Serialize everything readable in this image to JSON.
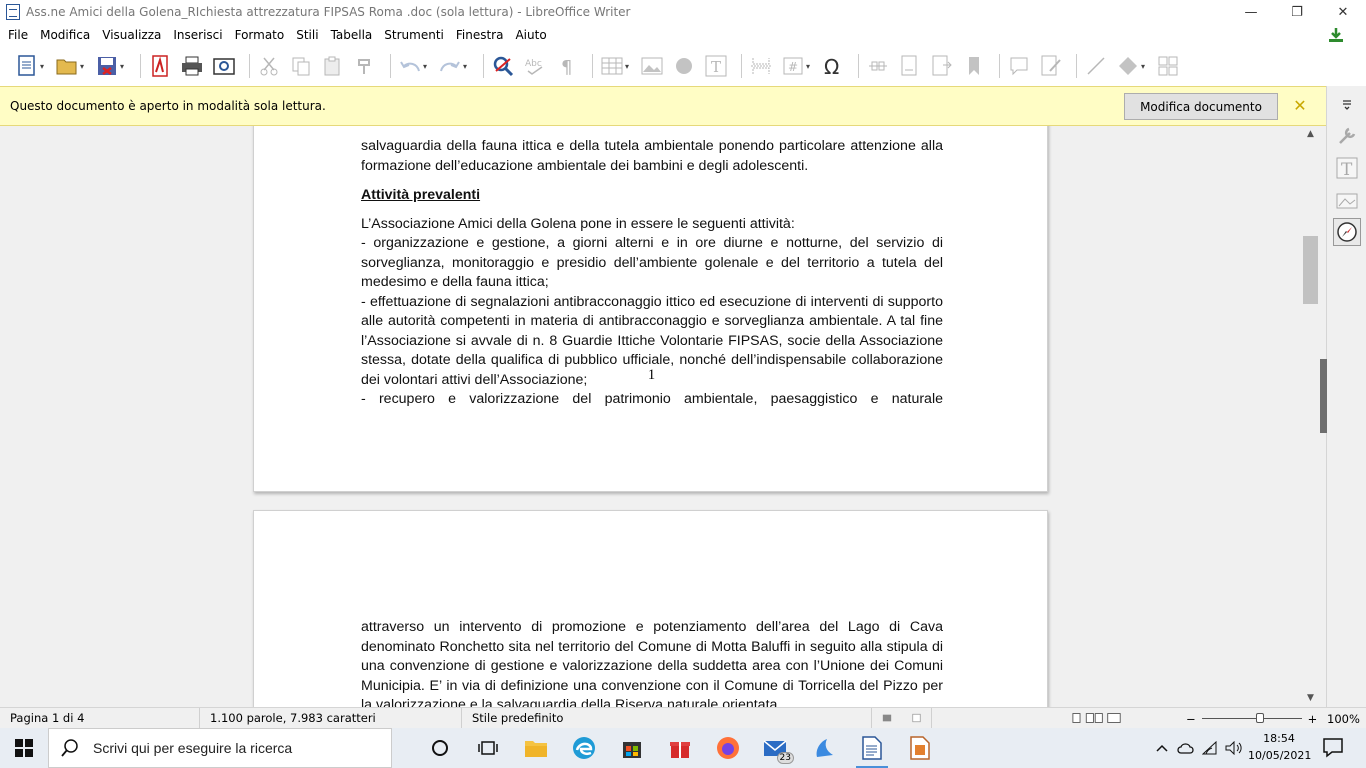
{
  "window": {
    "title": "Ass.ne Amici della Golena_RIchiesta attrezzatura FIPSAS Roma .doc (sola lettura) - LibreOffice Writer",
    "min_glyph": "—",
    "max_glyph": "❐",
    "close_glyph": "✕"
  },
  "menu": {
    "items": [
      "File",
      "Modifica",
      "Visualizza",
      "Inserisci",
      "Formato",
      "Stili",
      "Tabella",
      "Strumenti",
      "Finestra",
      "Aiuto"
    ]
  },
  "infobar": {
    "message": "Questo documento è aperto in modalità sola lettura.",
    "button_label": "Modifica documento",
    "close_glyph": "✕"
  },
  "document": {
    "page1": {
      "para_intro": "salvaguardia della fauna ittica e della tutela ambientale ponendo particolare attenzione alla formazione dell’educazione ambientale dei bambini e degli adolescenti.",
      "heading": "Attività prevalenti ",
      "para_lead": "L’Associazione Amici della Golena pone in essere le seguenti attività:",
      "para_item1": "- organizzazione e gestione, a giorni alterni e in ore diurne e notturne, del servizio di sorveglianza, monitoraggio e presidio dell’ambiente golenale e del territorio a tutela del medesimo e della fauna ittica;",
      "para_item2": "- effettuazione di segnalazioni antibracconaggio ittico ed esecuzione di interventi di supporto alle autorità competenti in materia di antibracconaggio e sorveglianza ambientale. A tal fine l’Associazione si avvale di n. 8 Guardie Ittiche Volontarie FIPSAS, socie della Associazione stessa, dotate della qualifica di pubblico ufficiale, nonché dell’indispensabile collaborazione dei volontari attivi dell’Associazione;",
      "para_item3": "- recupero e valorizzazione del patrimonio ambientale, paesaggistico e naturale",
      "page_number": "1"
    },
    "page2": {
      "para_cont": "attraverso un intervento di promozione e potenziamento dell’area del Lago di Cava denominato Ronchetto sita nel territorio del Comune di Motta Baluffi in seguito alla stipula di una convenzione di gestione e valorizzazione della suddetta area con l’Unione dei Comuni Municipia.  E’ in via di definizione una convenzione con il Comune di Torricella del Pizzo per la valorizzazione e la salvaguardia della Riserva naturale orientata"
    }
  },
  "statusbar": {
    "page": "Pagina 1 di 4",
    "words": "1.100 parole, 7.983 caratteri",
    "style": "Stile predefinito",
    "zoom_minus": "−",
    "zoom_plus": "+",
    "zoom": "100%",
    "zoom_fraction": 0.58
  },
  "taskbar": {
    "search_placeholder": "Scrivi qui per eseguire la ricerca",
    "mail_badge": "23",
    "time": "18:54",
    "date": "10/05/2021"
  },
  "colors": {
    "infobar_bg": "#fffdc5",
    "accent": "#2b5797"
  }
}
